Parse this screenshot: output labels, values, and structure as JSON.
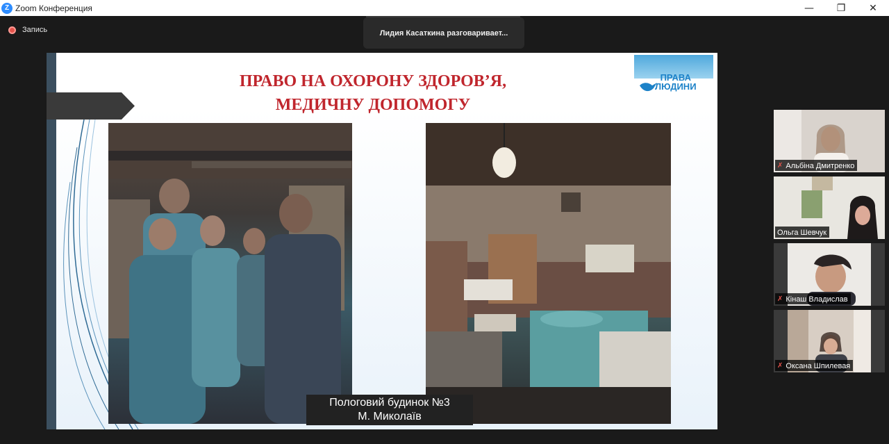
{
  "window": {
    "app_icon": "Z",
    "title": "Zoom Конференция",
    "controls": {
      "minimize": "—",
      "maximize": "❐",
      "close": "✕"
    }
  },
  "recording": {
    "label": "Запись",
    "color": "#e5534b"
  },
  "active_speaker": {
    "text": "Лидия Касаткина разговаривает..."
  },
  "slide": {
    "title_line1": "ПРАВО НА ОХОРОНУ ЗДОРОВ’Я,",
    "title_line2": "МЕДИЧНУ ДОПОМОГУ",
    "title_color": "#c0262d",
    "logo": {
      "line1": "ПРАВА",
      "line2": "ЛЮДИНИ"
    },
    "caption_line1": "Пологовий будинок №3",
    "caption_line2": "М. Миколаїв"
  },
  "participants": [
    {
      "name": "Альбіна Дмитренко",
      "muted": true,
      "icon": "mic-off-icon"
    },
    {
      "name": "Ольга Шевчук",
      "muted": false
    },
    {
      "name": "Кінаш Владислав",
      "muted": true,
      "icon": "mic-off-icon"
    },
    {
      "name": "Оксана Шпилевая",
      "muted": true,
      "icon": "mic-off-icon"
    }
  ]
}
